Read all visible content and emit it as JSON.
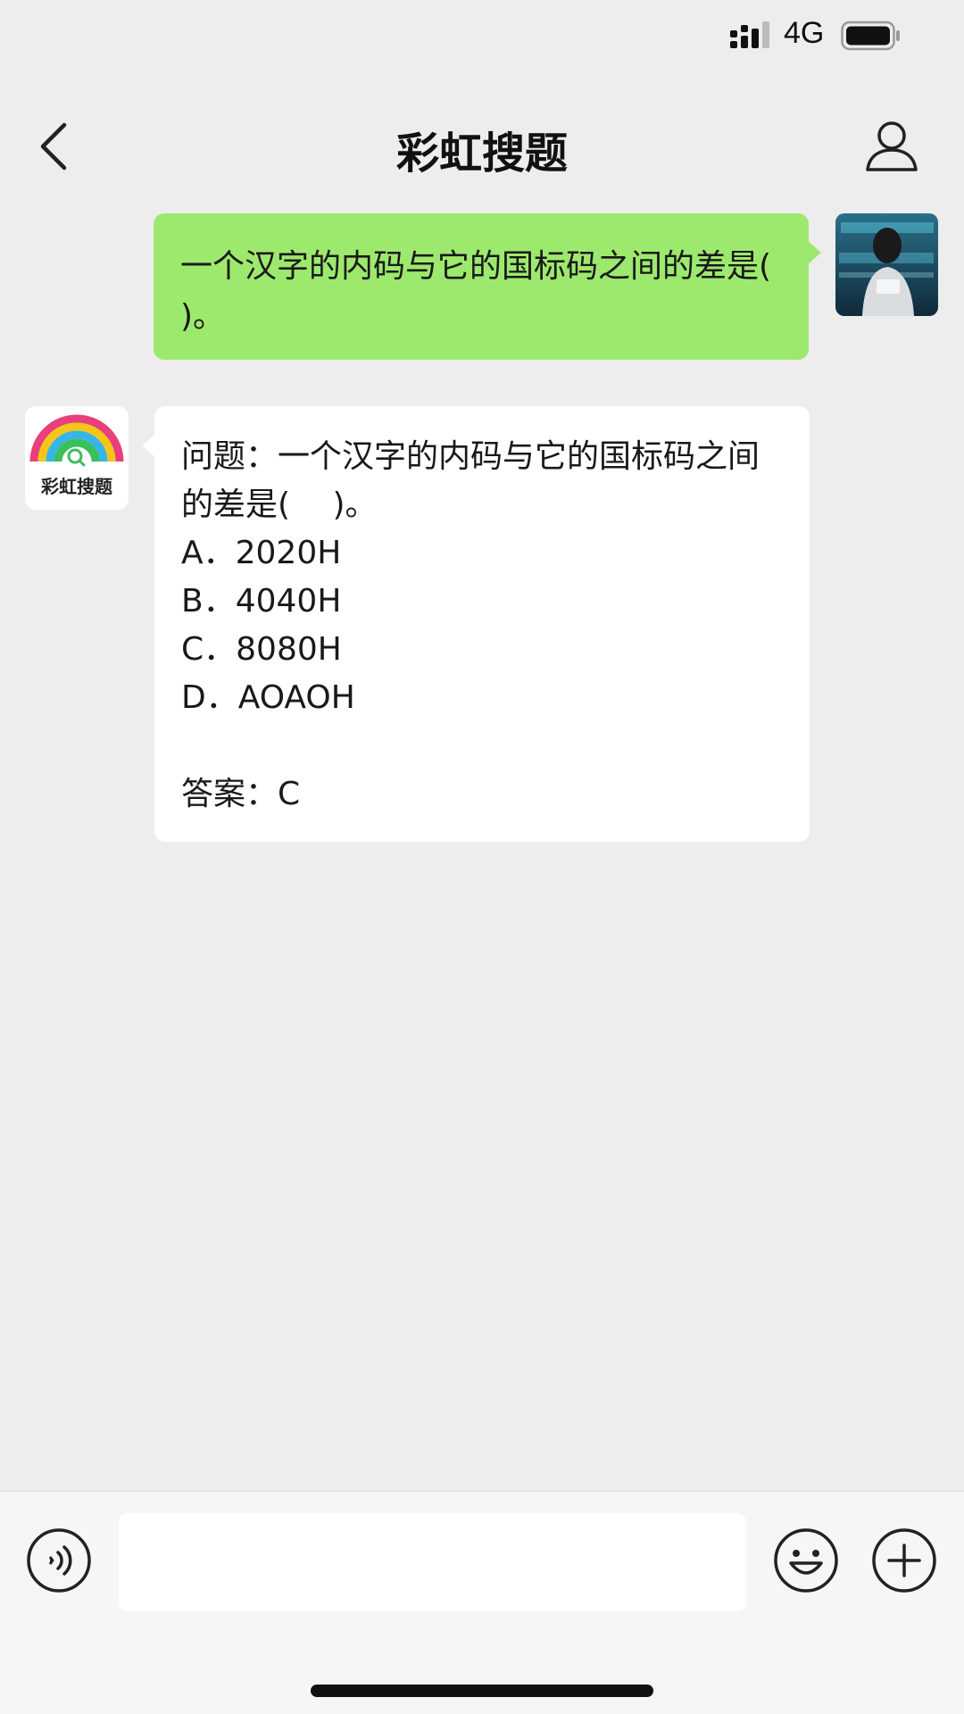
{
  "status_bar": {
    "network": "4G",
    "icons": [
      "signal-icon",
      "battery-icon"
    ]
  },
  "nav": {
    "title": "彩虹搜题",
    "back_icon": "chevron-left-icon",
    "profile_icon": "person-icon"
  },
  "messages": [
    {
      "sender": "user",
      "text": "一个汉字的内码与它的国标码之间的差是(　 )。"
    },
    {
      "sender": "bot",
      "avatar_label": "彩虹搜题",
      "lines": [
        "问题：一个汉字的内码与它的国标码之间",
        "的差是(　 )。",
        "A．2020H",
        "B．4040H",
        "C．8080H",
        "D．AOAOH"
      ],
      "answer": "答案：C"
    }
  ],
  "input_bar": {
    "placeholder": "",
    "icons": [
      "voice-icon",
      "emoji-icon",
      "plus-icon"
    ]
  }
}
